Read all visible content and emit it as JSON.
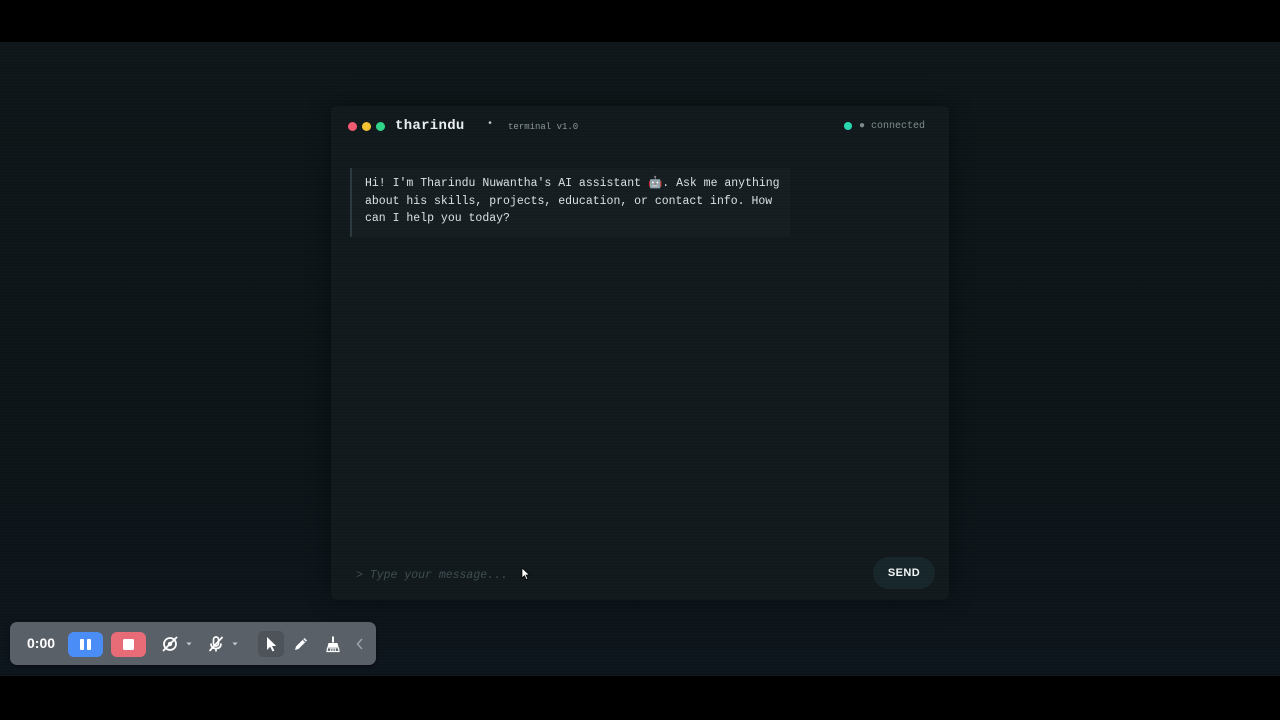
{
  "terminal": {
    "brand": "tharindu",
    "separator": "•",
    "version": "terminal v1.0",
    "status": "● connected",
    "status_color": "#27d7b0",
    "window_dots": [
      "#ef5a6f",
      "#f1c232",
      "#2fd38a"
    ]
  },
  "messages": [
    {
      "role": "assistant",
      "text": "Hi! I'm Tharindu Nuwantha's AI assistant 🤖. Ask me anything about his skills, projects, education, or contact info. How can I help you today?"
    }
  ],
  "composer": {
    "placeholder": "> Type your message...",
    "value": "",
    "send_label": "SEND"
  },
  "recorder_toolbar": {
    "time": "0:00",
    "pause_color": "#4b8df6",
    "stop_color": "#e86b78",
    "tools": [
      "pause-icon",
      "stop-icon",
      "camera-off-icon",
      "mic-off-icon",
      "pointer-icon",
      "pen-icon",
      "eraser-icon",
      "collapse-chevron-icon"
    ]
  }
}
